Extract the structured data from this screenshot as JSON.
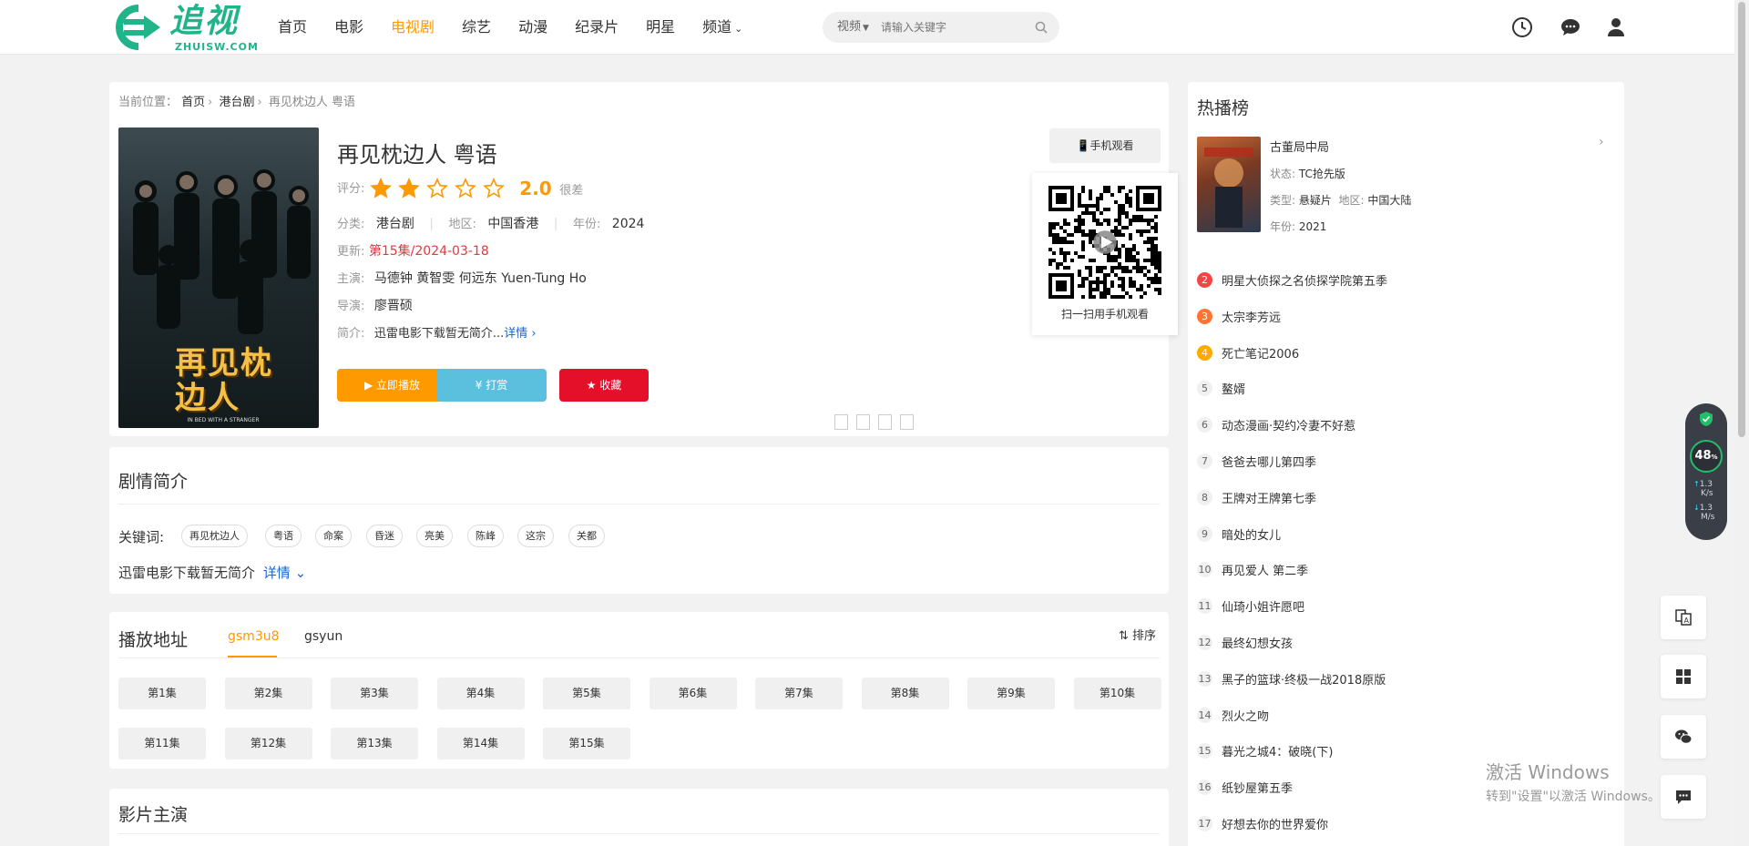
{
  "header": {
    "logo_cn": "追视",
    "logo_en": "ZHUISW.COM",
    "nav": [
      "首页",
      "电影",
      "电视剧",
      "综艺",
      "动漫",
      "纪录片",
      "明星",
      "频道"
    ],
    "nav_active_index": 2,
    "search": {
      "category": "视频",
      "placeholder": "请输入关键字"
    },
    "icons": [
      "clock-icon",
      "chat-icon",
      "user-icon"
    ]
  },
  "breadcrumb": {
    "label": "当前位置：",
    "items": [
      "首页",
      "港台剧",
      "再见枕边人 粤语"
    ]
  },
  "poster": {
    "title_art": "再见枕边人",
    "subtitle": "IN BED WITH A STRANGER"
  },
  "movie": {
    "title": "再见枕边人 粤语",
    "rating_label": "评分:",
    "rating_stars": 2,
    "rating_max": 5,
    "rating_value": "2.0",
    "rating_text": "很差",
    "category_label": "分类:",
    "category": "港台剧",
    "region_label": "地区:",
    "region": "中国香港",
    "year_label": "年份:",
    "year": "2024",
    "update_label": "更新:",
    "update": "第15集/2024-03-18",
    "cast_label": "主演:",
    "cast": "马德钟 黄智雯 何远东 Yuen-Tung Ho",
    "director_label": "导演:",
    "director": "廖晋硕",
    "intro_label": "简介:",
    "intro": "迅雷电影下载暂无简介...",
    "intro_more": "详情 ›"
  },
  "buttons": {
    "play": "▶ 立即播放",
    "tip": "¥ 打赏",
    "fav": "★ 收藏"
  },
  "mobile": {
    "button": "手机观看",
    "qr_caption": "扫一扫用手机观看"
  },
  "synopsis": {
    "title": "剧情简介",
    "keywords_label": "关键词:",
    "keywords": [
      "再见枕边人",
      "粤语",
      "命案",
      "昏迷",
      "亮美",
      "陈峰",
      "这宗",
      "关都"
    ],
    "text": "迅雷电影下载暂无简介",
    "more": "详情 ⌄"
  },
  "playlist": {
    "title": "播放地址",
    "tabs": [
      "gsm3u8",
      "gsyun"
    ],
    "active_tab": 0,
    "sort": "排序",
    "episodes": [
      "第1集",
      "第2集",
      "第3集",
      "第4集",
      "第5集",
      "第6集",
      "第7集",
      "第8集",
      "第9集",
      "第10集",
      "第11集",
      "第12集",
      "第13集",
      "第14集",
      "第15集"
    ]
  },
  "cast_section": {
    "title": "影片主演"
  },
  "hot": {
    "title": "热播榜",
    "top": {
      "title": "古董局中局",
      "status_label": "状态:",
      "status": "TC抢先版",
      "type_label": "类型:",
      "type": "悬疑片",
      "region_label": "地区:",
      "region": "中国大陆",
      "year_label": "年份:",
      "year": "2021"
    },
    "list": [
      {
        "rank": "2",
        "title": "明星大侦探之名侦探学院第五季"
      },
      {
        "rank": "3",
        "title": "太宗李芳远"
      },
      {
        "rank": "4",
        "title": "死亡笔记2006"
      },
      {
        "rank": "5",
        "title": "鳌婿"
      },
      {
        "rank": "6",
        "title": "动态漫画·契约冷妻不好惹"
      },
      {
        "rank": "7",
        "title": "爸爸去哪儿第四季"
      },
      {
        "rank": "8",
        "title": "王牌对王牌第七季"
      },
      {
        "rank": "9",
        "title": "暗处的女儿"
      },
      {
        "rank": "10",
        "title": "再见爱人 第二季"
      },
      {
        "rank": "11",
        "title": "仙琦小姐许愿吧"
      },
      {
        "rank": "12",
        "title": "最终幻想女孩"
      },
      {
        "rank": "13",
        "title": "黑子的篮球·终极一战2018原版"
      },
      {
        "rank": "14",
        "title": "烈火之吻"
      },
      {
        "rank": "15",
        "title": "暮光之城4：破晓(下)"
      },
      {
        "rank": "16",
        "title": "纸钞屋第五季"
      },
      {
        "rank": "17",
        "title": "好想去你的世界爱你"
      }
    ]
  },
  "widget": {
    "percent": "48",
    "unit": "%",
    "up": "1.3",
    "up_unit": "K/s",
    "down": "1.3",
    "down_unit": "M/s"
  },
  "sidebar_tools": [
    "translate-icon",
    "windows-icon",
    "wechat-icon",
    "comment-icon"
  ],
  "watermark": {
    "line1": "激活 Windows",
    "line2": "转到\"设置\"以激活 Windows。"
  },
  "colors": {
    "accent": "#ff9900",
    "red": "#e4393c",
    "brand": "#21b38a",
    "tip": "#5bc0de"
  }
}
